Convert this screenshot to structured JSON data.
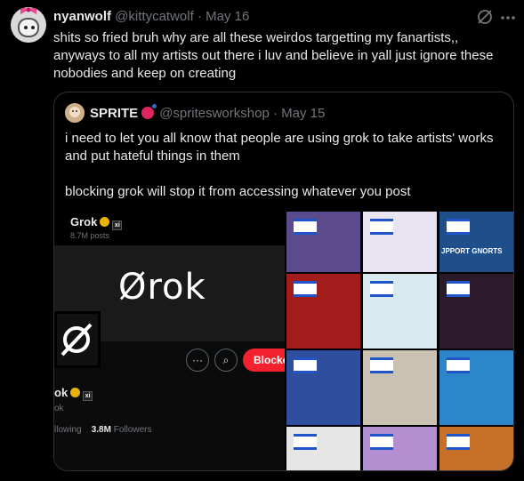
{
  "tweet": {
    "author_name": "nyanwolf",
    "author_handle": "@kittycatwolf",
    "separator": " · ",
    "date": "May 16",
    "text": "shits so fried bruh why are all these weirdos targetting my fanartists,, anyways to all my artists out there i luv and believe in yall just ignore these nobodies and keep on creating"
  },
  "quote": {
    "author_name": "SPRITE",
    "author_handle": "@spritesworkshop",
    "separator": " · ",
    "date": "May 15",
    "paragraphs": [
      "i need to let you all know that people are using grok to take artists' works and put hateful things in them",
      "blocking grok will stop it from accessing whatever you post"
    ]
  },
  "media_profile": {
    "name": "Grok",
    "posts": "8.7M posts",
    "logo_text": "Ørok",
    "more_label": "···",
    "search_label": "⌕",
    "block_label": "Blocke",
    "name_cropped": "ok",
    "handle_cropped": "ok",
    "following_cropped": "llowing",
    "followers_count": "3.8M",
    "followers_label": "Followers",
    "xi_label": "xi"
  },
  "grid_tiles": [
    {
      "name": "tile-flag-unicorn",
      "bg": "#5b4a8c"
    },
    {
      "name": "tile-flag-waving",
      "bg": "#e8e4f2"
    },
    {
      "name": "tile-support-gnorts",
      "bg": "#1e4f8a",
      "caption": "JPPORT GNORTS"
    },
    {
      "name": "tile-ironman",
      "bg": "#a31c1c"
    },
    {
      "name": "tile-green-creature",
      "bg": "#d8e9f0"
    },
    {
      "name": "tile-demon-girl",
      "bg": "#2a1a2a"
    },
    {
      "name": "tile-blue-room",
      "bg": "#2f4f9e"
    },
    {
      "name": "tile-bird",
      "bg": "#c9c2b2"
    },
    {
      "name": "tile-green-monster",
      "bg": "#2d86c9"
    },
    {
      "name": "tile-sketch",
      "bg": "#e6e6e6"
    },
    {
      "name": "tile-purple-girl",
      "bg": "#b38fd1"
    },
    {
      "name": "tile-orange-creature",
      "bg": "#c7702a"
    }
  ],
  "colors": {
    "background": "#000000",
    "text": "#e7e9ea",
    "muted": "#71767b",
    "border": "#2f3336",
    "block_red": "#f4212e"
  },
  "icons": {
    "grok": "grok-icon",
    "more": "more-horizontal-icon"
  }
}
